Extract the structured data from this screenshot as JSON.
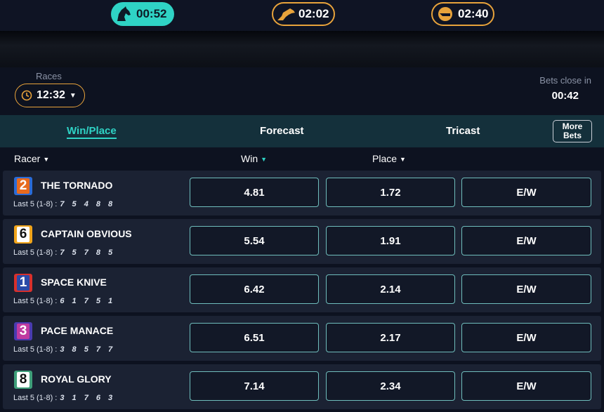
{
  "timers": [
    {
      "time": "00:52",
      "icon": "horse-head-icon",
      "active": true
    },
    {
      "time": "02:02",
      "icon": "greyhound-icon",
      "active": false
    },
    {
      "time": "02:40",
      "icon": "motor-helmet-icon",
      "active": false
    }
  ],
  "races": {
    "label": "Races",
    "selected": "12:32"
  },
  "bets_close": {
    "label": "Bets close in",
    "time": "00:42"
  },
  "tabs": {
    "win_place": "Win/Place",
    "forecast": "Forecast",
    "tricast": "Tricast",
    "more_bets_line1": "More",
    "more_bets_line2": "Bets"
  },
  "columns": {
    "racer": "Racer",
    "win": "Win",
    "place": "Place"
  },
  "last5_label": "Last 5 (1-8) :",
  "colors": {
    "accent": "#2fd3c5",
    "gold": "#e8a33b",
    "odds_border": "#6fbdbc"
  },
  "racers": [
    {
      "number": "2",
      "name": "THE TORNADO",
      "last5": "7 5 4 8 8",
      "win": "4.81",
      "place": "1.72",
      "ew": "E/W",
      "badge_bg": "#2a6bd6",
      "badge_inner": "#e76a1e",
      "badge_fg": "#ffffff"
    },
    {
      "number": "6",
      "name": "CAPTAIN OBVIOUS",
      "last5": "7 5 7 8 5",
      "win": "5.54",
      "place": "1.91",
      "ew": "E/W",
      "badge_bg": "#f1a51b",
      "badge_inner": "#ffffff",
      "badge_fg": "#111111"
    },
    {
      "number": "1",
      "name": "SPACE KNIVE",
      "last5": "6 1 7 5 1",
      "win": "6.42",
      "place": "2.14",
      "ew": "E/W",
      "badge_bg": "#d8302c",
      "badge_inner": "#2a4aa8",
      "badge_fg": "#ffffff"
    },
    {
      "number": "3",
      "name": "PACE MANACE",
      "last5": "3 8 5 7 7",
      "win": "6.51",
      "place": "2.17",
      "ew": "E/W",
      "badge_bg": "#4a3bb0",
      "badge_inner": "#c03ba0",
      "badge_fg": "#ffffff"
    },
    {
      "number": "8",
      "name": "ROYAL GLORY",
      "last5": "3 1 7 6 3",
      "win": "7.14",
      "place": "2.34",
      "ew": "E/W",
      "badge_bg": "#3f9f7a",
      "badge_inner": "#ffffff",
      "badge_fg": "#111111"
    }
  ]
}
